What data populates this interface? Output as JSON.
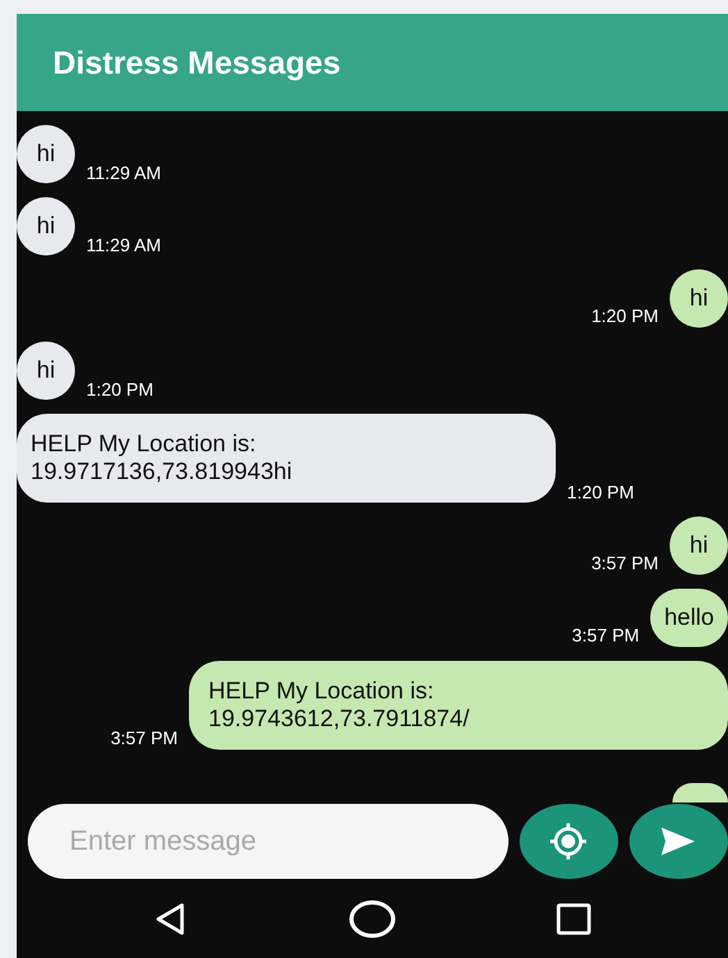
{
  "app_bar": {
    "title": "Distress Messages"
  },
  "messages": [
    {
      "kind": "incoming",
      "text": "hi",
      "time": "11:29 AM"
    },
    {
      "kind": "incoming",
      "text": "hi",
      "time": "11:29 AM"
    },
    {
      "kind": "outgoing",
      "text": "hi",
      "time": "1:20 PM"
    },
    {
      "kind": "incoming",
      "text": "hi",
      "time": "1:20 PM"
    },
    {
      "kind": "incoming",
      "text": "HELP My Location is:\n19.9717136,73.819943hi",
      "time": "1:20 PM"
    },
    {
      "kind": "outgoing",
      "text": "hi",
      "time": "3:57 PM"
    },
    {
      "kind": "outgoing",
      "text": "hello",
      "time": "3:57 PM"
    },
    {
      "kind": "outgoing",
      "text": "HELP My Location is:\n19.9743612,73.7911874/",
      "time": "3:57 PM"
    }
  ],
  "composer": {
    "placeholder": "Enter message"
  }
}
